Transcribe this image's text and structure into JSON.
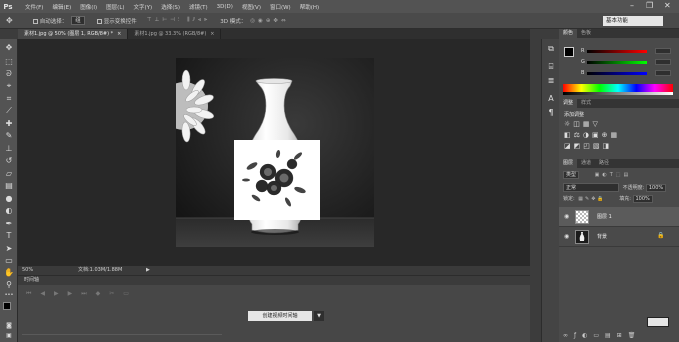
{
  "app": {
    "logo": "Ps"
  },
  "menu": [
    "文件(F)",
    "编辑(E)",
    "图像(I)",
    "图层(L)",
    "文字(Y)",
    "选择(S)",
    "滤镜(T)",
    "3D(D)",
    "视图(V)",
    "窗口(W)",
    "帮助(H)"
  ],
  "window_controls": {
    "minimize": "–",
    "restore": "❐",
    "close": "✕"
  },
  "options": {
    "auto_select_label": "自动选择：",
    "auto_select_value": "组",
    "show_transform_label": "显示变换控件",
    "mode_3d_label": "3D 模式：",
    "workspace": "基本功能"
  },
  "tabs": [
    {
      "label": "素材1.jpg @ 50% (图层 1, RGB/8#) *",
      "active": true
    },
    {
      "label": "素材1.jpg @ 33.3% (RGB/8#)",
      "active": false
    }
  ],
  "status": {
    "zoom": "50%",
    "doc_info": "文档:1.03M/1.88M"
  },
  "timeline": {
    "title": "时间轴",
    "create_button": "创建视频时间轴"
  },
  "panels": {
    "color_tabs": [
      "颜色",
      "色板"
    ],
    "color": {
      "r_label": "R",
      "g_label": "G",
      "b_label": "B"
    },
    "adjust_tabs": [
      "调整",
      "样式"
    ],
    "adjust_title": "添加调整",
    "layer_tabs": [
      "图层",
      "通道",
      "路径"
    ],
    "kind_label": "类型",
    "blend_mode": "正常",
    "opacity_label": "不透明度:",
    "opacity_value": "100%",
    "lock_label": "锁定:",
    "fill_label": "填充:",
    "fill_value": "100%",
    "layers": [
      {
        "name": "图层 1",
        "selected": true
      },
      {
        "name": "背景",
        "selected": false
      }
    ]
  },
  "icons": {
    "tools": [
      "move-tool-icon",
      "marquee-tool-icon",
      "lasso-tool-icon",
      "quick-select-icon",
      "crop-tool-icon",
      "eyedropper-icon",
      "healing-brush-icon",
      "brush-tool-icon",
      "clone-stamp-icon",
      "history-brush-icon",
      "eraser-icon",
      "gradient-icon",
      "blur-icon",
      "dodge-icon",
      "pen-tool-icon",
      "type-tool-icon",
      "path-select-icon",
      "shape-tool-icon",
      "hand-tool-icon",
      "zoom-tool-icon"
    ]
  },
  "colors": {
    "accent_blue": "#4d7fbf",
    "workspace_bg": "#282828",
    "panel_bg": "#4a4a4a"
  }
}
